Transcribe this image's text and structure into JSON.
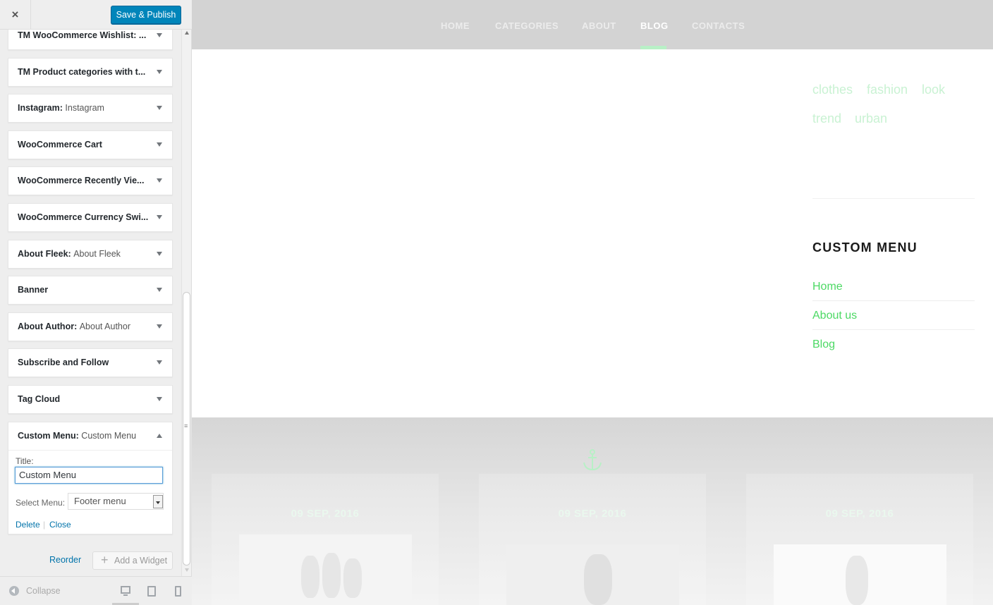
{
  "header": {
    "close_label": "×",
    "save_label": "Save & Publish"
  },
  "widgets": [
    {
      "title": "TM WooCommerce Wishlist: ...",
      "subtitle": ""
    },
    {
      "title": "TM Product categories with t...",
      "subtitle": ""
    },
    {
      "title": "Instagram:",
      "subtitle": "Instagram"
    },
    {
      "title": "WooCommerce Cart",
      "subtitle": ""
    },
    {
      "title": "WooCommerce Recently Vie...",
      "subtitle": ""
    },
    {
      "title": "WooCommerce Currency Swi...",
      "subtitle": ""
    },
    {
      "title": "About Fleek:",
      "subtitle": "About Fleek"
    },
    {
      "title": "Banner",
      "subtitle": ""
    },
    {
      "title": "About Author:",
      "subtitle": "About Author"
    },
    {
      "title": "Subscribe and Follow",
      "subtitle": ""
    },
    {
      "title": "Tag Cloud",
      "subtitle": ""
    }
  ],
  "open_widget": {
    "title": "Custom Menu:",
    "subtitle": "Custom Menu",
    "title_label": "Title:",
    "title_value": "Custom Menu",
    "select_label": "Select Menu:",
    "select_value": "Footer menu",
    "delete_label": "Delete",
    "separator": "|",
    "close_label": "Close"
  },
  "actions": {
    "reorder_label": "Reorder",
    "add_widget_label": "Add a Widget"
  },
  "footer": {
    "collapse_label": "Collapse"
  },
  "preview": {
    "nav": [
      "HOME",
      "CATEGORIES",
      "ABOUT",
      "BLOG",
      "CONTACTS"
    ],
    "active_nav": "BLOG",
    "tags": [
      "clothes",
      "fashion",
      "look",
      "trend",
      "urban"
    ],
    "custom_menu": {
      "heading": "CUSTOM MENU",
      "links": [
        "Home",
        "About us",
        "Blog"
      ]
    },
    "posts": [
      {
        "date": "09 SEP, 2016"
      },
      {
        "date": "09 SEP, 2016"
      },
      {
        "date": "09 SEP, 2016"
      }
    ]
  },
  "colors": {
    "publish_button": "#0085ba",
    "link": "#0073aa",
    "accent_green": "#4cd964",
    "nav_bar": "#d3d3d3"
  }
}
